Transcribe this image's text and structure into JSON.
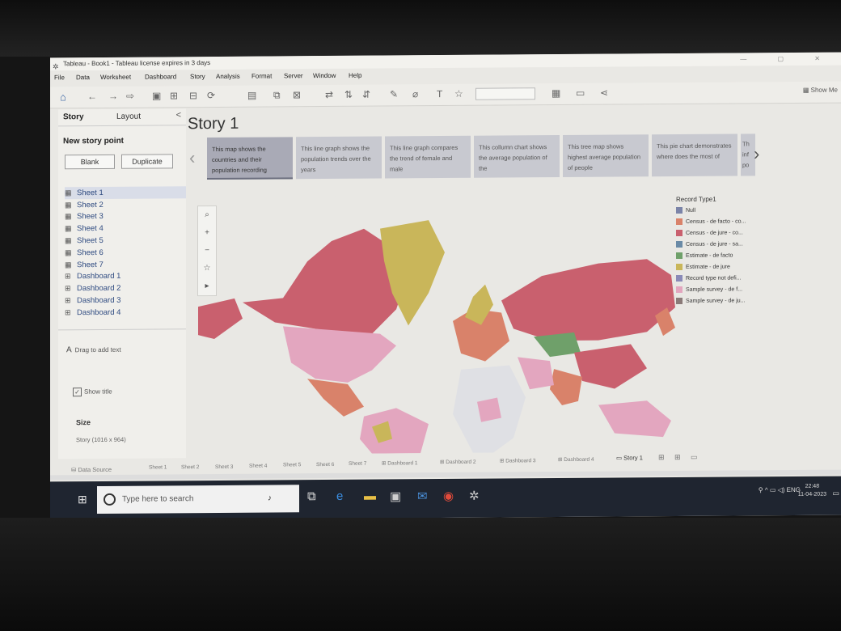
{
  "window": {
    "title": "Tableau - Book1 - Tableau license expires in 3 days"
  },
  "menu": [
    "File",
    "Data",
    "Worksheet",
    "Dashboard",
    "Story",
    "Analysis",
    "Format",
    "Server",
    "Window",
    "Help"
  ],
  "toolbar": {
    "show_me": "Show Me"
  },
  "panel": {
    "tabs": {
      "story": "Story",
      "layout": "Layout"
    },
    "new_story_point": "New story point",
    "blank": "Blank",
    "duplicate": "Duplicate",
    "sheets": [
      "Sheet 1",
      "Sheet 2",
      "Sheet 3",
      "Sheet 4",
      "Sheet 5",
      "Sheet 6",
      "Sheet 7",
      "Dashboard 1",
      "Dashboard 2",
      "Dashboard 3",
      "Dashboard 4"
    ],
    "drag_text": "Drag to add text",
    "show_title": "Show title",
    "size_label": "Size",
    "size_value": "Story (1016 x 964)"
  },
  "story": {
    "title": "Story 1",
    "points": [
      "This map shows the countries and their population recording",
      "This line graph shows the population trends over the years",
      "This line graph compares the trend of female and male",
      "This collumn chart shows the average population of the",
      "This tree map shows highest average population of people",
      "This pie chart demonstrates where does the most of",
      "Th inf po"
    ]
  },
  "legend": {
    "title": "Record Type1",
    "items": [
      {
        "label": "Null",
        "color": "#7b84a8"
      },
      {
        "label": "Census - de facto - co...",
        "color": "#d9826a"
      },
      {
        "label": "Census - de jure - co...",
        "color": "#c9606e"
      },
      {
        "label": "Census - de jure - sa...",
        "color": "#6a8aa6"
      },
      {
        "label": "Estimate - de facto",
        "color": "#6fa06a"
      },
      {
        "label": "Estimate - de jure",
        "color": "#c9b65a"
      },
      {
        "label": "Record type not defi...",
        "color": "#8a8ab8"
      },
      {
        "label": "Sample survey - de f...",
        "color": "#e3a6bf"
      },
      {
        "label": "Sample survey - de ju...",
        "color": "#8a7a78"
      }
    ]
  },
  "bottom_tabs": {
    "data_source": "Data Source",
    "tabs": [
      "Sheet 1",
      "Sheet 2",
      "Sheet 3",
      "Sheet 4",
      "Sheet 5",
      "Sheet 6",
      "Sheet 7",
      "Dashboard 1",
      "Dashboard 2",
      "Dashboard 3",
      "Dashboard 4",
      "Story 1"
    ]
  },
  "taskbar": {
    "search_placeholder": "Type here to search",
    "lang": "ENG",
    "time": "22:48",
    "date": "11-04-2023"
  }
}
